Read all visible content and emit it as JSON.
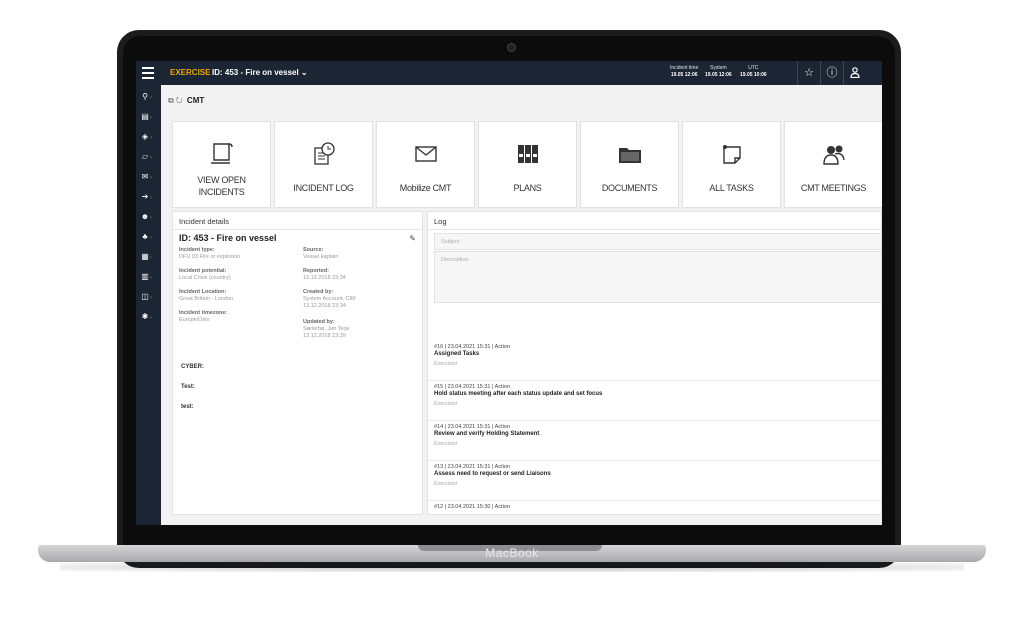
{
  "device": {
    "brand": "MacBook"
  },
  "topbar": {
    "exercise_label": "EXERCISE",
    "title": "ID: 453 - Fire on vessel ⌄",
    "clocks": [
      {
        "label": "Incident time",
        "value": "19.05 12:06"
      },
      {
        "label": "System",
        "value": "19.05 12:06"
      },
      {
        "label": "UTC",
        "value": "19.05 10:06"
      }
    ],
    "icons": [
      "star-icon",
      "info-icon",
      "user-icon"
    ]
  },
  "sidebar": {
    "items": [
      "search-icon",
      "list-icon",
      "tags-icon",
      "note-icon",
      "mail-icon",
      "arrow-circle-icon",
      "people-icon",
      "person-add-icon",
      "grid-icon",
      "table-icon",
      "columns-icon",
      "gear-icon"
    ]
  },
  "breadcrumb": {
    "icons": "⧉ ↻",
    "label": "CMT"
  },
  "tiles": [
    {
      "label1": "VIEW OPEN",
      "label2": "INCIDENTS",
      "icon": "open-incident-icon"
    },
    {
      "label1": "INCIDENT LOG",
      "label2": "",
      "icon": "log-clock-icon"
    },
    {
      "label1": "Mobilize CMT",
      "label2": "",
      "icon": "envelope-icon"
    },
    {
      "label1": "PLANS",
      "label2": "",
      "icon": "binders-icon"
    },
    {
      "label1": "DOCUMENTS",
      "label2": "",
      "icon": "folder-icon"
    },
    {
      "label1": "ALL TASKS",
      "label2": "",
      "icon": "task-note-icon"
    },
    {
      "label1": "CMT MEETINGS",
      "label2": "",
      "icon": "meeting-people-icon"
    }
  ],
  "details": {
    "header": "Incident details",
    "title": "ID: 453 - Fire on vessel",
    "left": [
      {
        "label": "Incident type:",
        "value": "DFU 03 Fire or explosion"
      },
      {
        "label": "Incident potential:",
        "value": "Local Crisis (country)"
      },
      {
        "label": "Incident Location:",
        "value": "Great Britain - London"
      },
      {
        "label": "Incident timezone:",
        "value": "Europe/Oslo"
      }
    ],
    "right": [
      {
        "label": "Source:",
        "value": "Vessel kaptain"
      },
      {
        "label": "Reported:",
        "value": "13.12.2018 23:34"
      },
      {
        "label": "Created by:",
        "value": "System Account, CIM\n13.12.2018 23:34"
      },
      {
        "label": "Updated by:",
        "value": "Sæterbø, Jan Terje\n13.12.2018 23:39"
      }
    ],
    "extras": [
      "CYBER:",
      "Test:",
      "test:"
    ]
  },
  "log": {
    "header": "Log",
    "subject_placeholder": "Subject",
    "description_placeholder": "Description",
    "entries": [
      {
        "meta": "#16 | 23.04.2021 15:31 | Action",
        "title": "Assigned Tasks",
        "status": "Executed"
      },
      {
        "meta": "#15 | 23.04.2021 15:31 | Action",
        "title": "Hold status meeting after each status update and set focus",
        "status": "Executed"
      },
      {
        "meta": "#14 | 23.04.2021 15:31 | Action",
        "title": "Review and verify Holding Statement",
        "status": "Executed"
      },
      {
        "meta": "#13 | 23.04.2021 15:31 | Action",
        "title": "Assess need to request or send Liaisons",
        "status": "Executed"
      },
      {
        "meta": "#12 | 23.04.2021 15:30 | Action",
        "title": "",
        "status": ""
      }
    ]
  }
}
